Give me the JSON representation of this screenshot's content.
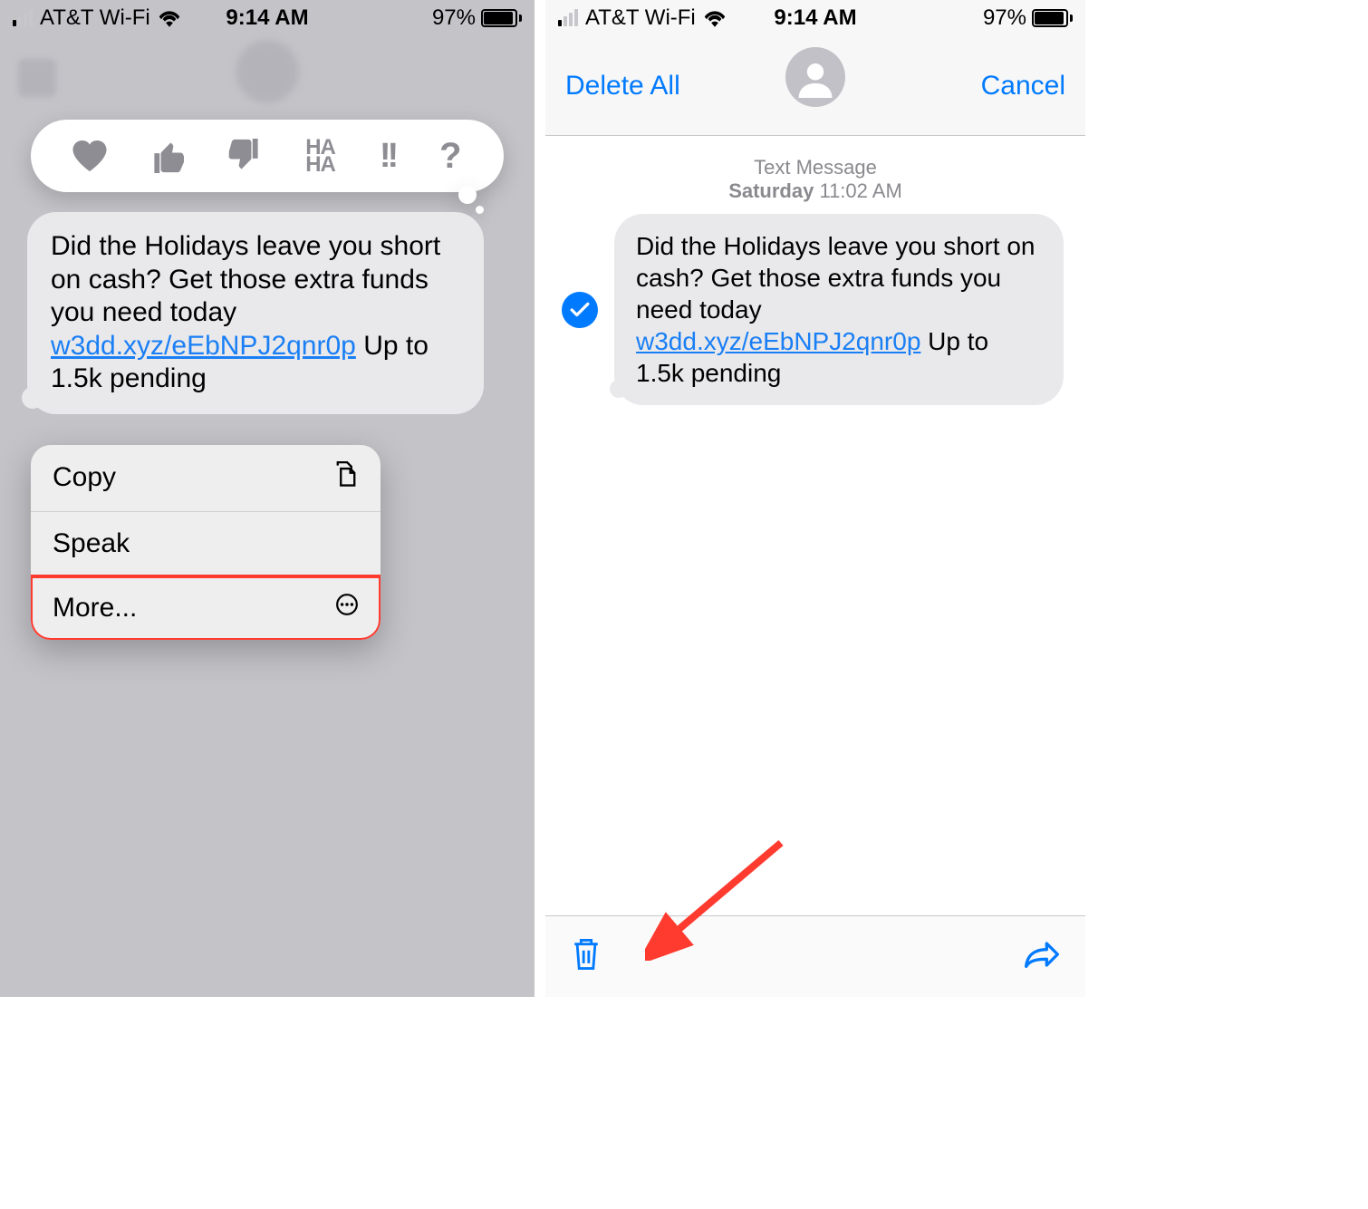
{
  "status": {
    "carrier": "AT&T Wi-Fi",
    "time": "9:14 AM",
    "battery_pct": "97%"
  },
  "left": {
    "message_text_pre": " Did the Holidays leave you short on cash? Get those extra funds you need today ",
    "message_link": "w3dd.xyz/eEbNPJ2qnr0p",
    "message_text_post": " Up to 1.5k pending",
    "menu": {
      "copy": "Copy",
      "speak": "Speak",
      "more": "More..."
    },
    "reactions": [
      "heart",
      "thumbs-up",
      "thumbs-down",
      "haha",
      "exclaim",
      "question"
    ]
  },
  "right": {
    "delete_all": "Delete All",
    "cancel": "Cancel",
    "meta_label": "Text Message",
    "meta_day": "Saturday",
    "meta_time": "11:02 AM",
    "message_text_pre": " Did the Holidays leave you short on cash? Get those extra funds you need today ",
    "message_link": "w3dd.xyz/eEbNPJ2qnr0p",
    "message_text_post": " Up to 1.5k pending"
  }
}
